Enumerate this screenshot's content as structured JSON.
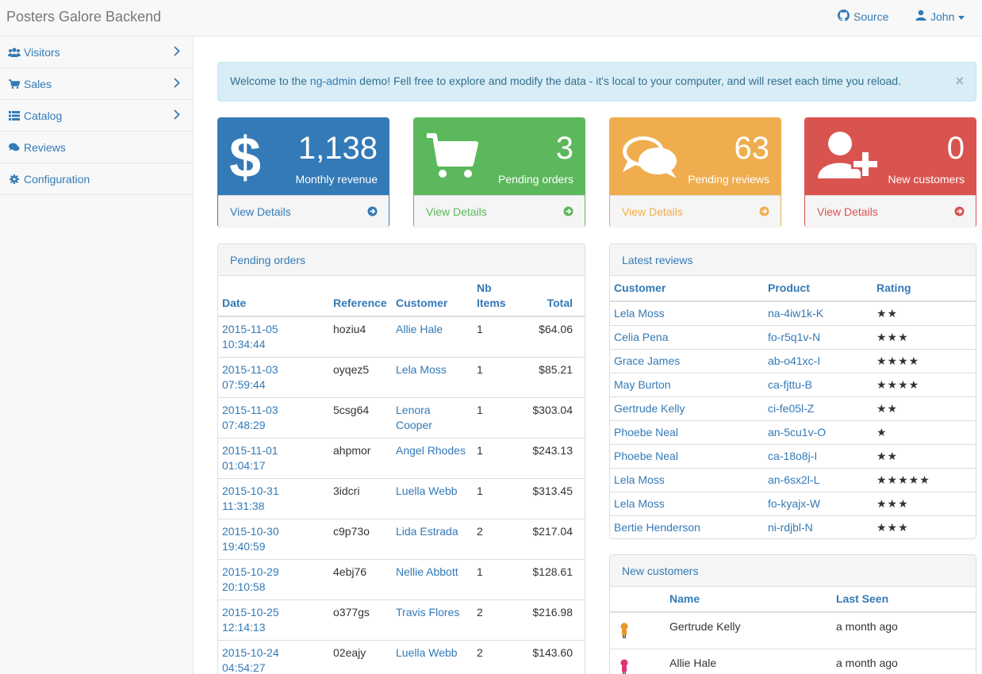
{
  "app": {
    "title": "Posters Galore Backend",
    "source_label": "Source",
    "user_label": "John"
  },
  "sidebar": {
    "items": [
      {
        "label": "Visitors",
        "icon": "users-icon",
        "has_submenu": true
      },
      {
        "label": "Sales",
        "icon": "cart-icon",
        "has_submenu": true
      },
      {
        "label": "Catalog",
        "icon": "list-icon",
        "has_submenu": true
      },
      {
        "label": "Reviews",
        "icon": "comments-icon",
        "has_submenu": false
      },
      {
        "label": "Configuration",
        "icon": "cog-icon",
        "has_submenu": false
      }
    ]
  },
  "alert": {
    "prefix": "Welcome to the ",
    "link": "ng-admin",
    "suffix": " demo! Fell free to explore and modify the data - it's local to your computer, and will reset each time you reload.",
    "close": "×"
  },
  "cards": [
    {
      "value": "1,138",
      "label": "Monthly revenue",
      "link": "View Details",
      "icon": "dollar-icon",
      "color": "#337ab7"
    },
    {
      "value": "3",
      "label": "Pending orders",
      "link": "View Details",
      "icon": "cart-icon",
      "color": "#5cb85c"
    },
    {
      "value": "63",
      "label": "Pending reviews",
      "link": "View Details",
      "icon": "comments-icon",
      "color": "#f0ad4e"
    },
    {
      "value": "0",
      "label": "New customers",
      "link": "View Details",
      "icon": "user-plus-icon",
      "color": "#d9534f"
    }
  ],
  "pending_orders": {
    "title": "Pending orders",
    "columns": {
      "date": "Date",
      "reference": "Reference",
      "customer": "Customer",
      "nb_items_1": "Nb",
      "nb_items_2": "Items",
      "total": "Total"
    },
    "rows": [
      {
        "date1": "2015-11-05",
        "date2": "10:34:44",
        "reference": "hoziu4",
        "customer": "Allie Hale",
        "items": "1",
        "total": "$64.06"
      },
      {
        "date1": "2015-11-03",
        "date2": "07:59:44",
        "reference": "oyqez5",
        "customer": "Lela Moss",
        "items": "1",
        "total": "$85.21"
      },
      {
        "date1": "2015-11-03",
        "date2": "07:48:29",
        "reference": "5csg64",
        "customer": "Lenora Cooper",
        "items": "1",
        "total": "$303.04"
      },
      {
        "date1": "2015-11-01",
        "date2": "01:04:17",
        "reference": "ahpmor",
        "customer": "Angel Rhodes",
        "items": "1",
        "total": "$243.13"
      },
      {
        "date1": "2015-10-31",
        "date2": "11:31:38",
        "reference": "3idcri",
        "customer": "Luella Webb",
        "items": "1",
        "total": "$313.45"
      },
      {
        "date1": "2015-10-30",
        "date2": "19:40:59",
        "reference": "c9p73o",
        "customer": "Lida Estrada",
        "items": "2",
        "total": "$217.04"
      },
      {
        "date1": "2015-10-29",
        "date2": "20:10:58",
        "reference": "4ebj76",
        "customer": "Nellie Abbott",
        "items": "1",
        "total": "$128.61"
      },
      {
        "date1": "2015-10-25",
        "date2": "12:14:13",
        "reference": "o377gs",
        "customer": "Travis Flores",
        "items": "2",
        "total": "$216.98"
      },
      {
        "date1": "2015-10-24",
        "date2": "04:54:27",
        "reference": "02eajy",
        "customer": "Luella Webb",
        "items": "2",
        "total": "$143.60"
      }
    ]
  },
  "latest_reviews": {
    "title": "Latest reviews",
    "columns": {
      "customer": "Customer",
      "product": "Product",
      "rating": "Rating"
    },
    "rows": [
      {
        "customer": "Lela Moss",
        "product": "na-4iw1k-K",
        "rating": "★★"
      },
      {
        "customer": "Celia Pena",
        "product": "fo-r5q1v-N",
        "rating": "★★★"
      },
      {
        "customer": "Grace James",
        "product": "ab-o41xc-I",
        "rating": "★★★★"
      },
      {
        "customer": "May Burton",
        "product": "ca-fjttu-B",
        "rating": "★★★★"
      },
      {
        "customer": "Gertrude Kelly",
        "product": "ci-fe05l-Z",
        "rating": "★★"
      },
      {
        "customer": "Phoebe Neal",
        "product": "an-5cu1v-O",
        "rating": "★"
      },
      {
        "customer": "Phoebe Neal",
        "product": "ca-18o8j-I",
        "rating": "★★"
      },
      {
        "customer": "Lela Moss",
        "product": "an-6sx2l-L",
        "rating": "★★★★★"
      },
      {
        "customer": "Lela Moss",
        "product": "fo-kyajx-W",
        "rating": "★★★"
      },
      {
        "customer": "Bertie Henderson",
        "product": "ni-rdjbl-N",
        "rating": "★★★"
      }
    ]
  },
  "new_customers": {
    "title": "New customers",
    "columns": {
      "name": "Name",
      "last_seen": "Last Seen"
    },
    "rows": [
      {
        "name": "Gertrude Kelly",
        "last_seen": "a month ago",
        "avatar_color": "#e8962f"
      },
      {
        "name": "Allie Hale",
        "last_seen": "a month ago",
        "avatar_color": "#e0337a"
      }
    ]
  }
}
